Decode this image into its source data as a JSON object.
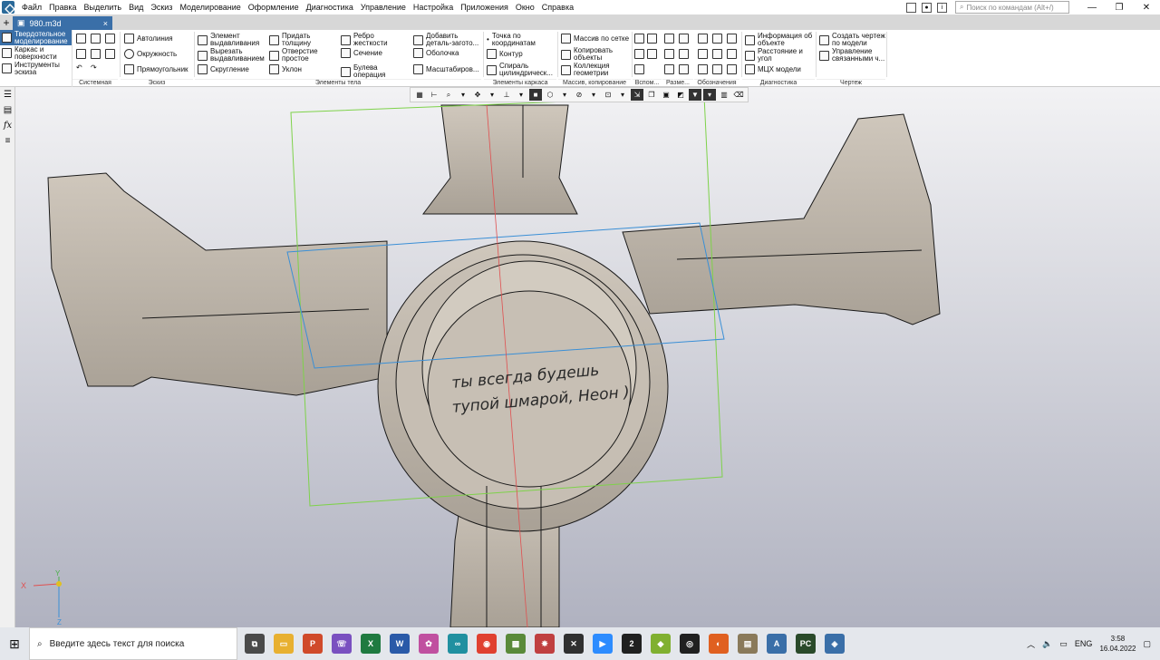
{
  "menu": [
    "Файл",
    "Правка",
    "Выделить",
    "Вид",
    "Эскиз",
    "Моделирование",
    "Оформление",
    "Диагностика",
    "Управление",
    "Настройка",
    "Приложения",
    "Окно",
    "Справка"
  ],
  "search": {
    "placeholder": "Поиск по командам (Alt+/)"
  },
  "tab": {
    "title": "980.m3d",
    "plus": "+",
    "close": "×"
  },
  "side": [
    "Твердотельное моделирование",
    "Каркас и поверхности",
    "Инструменты эскиза"
  ],
  "groups": {
    "system": "Системная",
    "sketch": "Эскиз",
    "body": "Элементы тела",
    "frame": "Элементы каркаса",
    "array": "Массив, копирование",
    "aux": "Вспом...",
    "size": "Разме...",
    "notation": "Обозначения",
    "diag": "Диагностика",
    "drawing": "Чертеж"
  },
  "sketch": [
    "Автолиния",
    "Окружность",
    "Прямоугольник"
  ],
  "body": [
    "Элемент выдавливания",
    "Вырезать выдавливанием",
    "Скругление",
    "Придать толщину",
    "Отверстие простое",
    "Уклон",
    "Ребро жесткости",
    "Сечение",
    "Булева операция",
    "Добавить деталь-загото...",
    "Оболочка",
    "Масштабиров..."
  ],
  "frame": [
    "Точка по координатам",
    "Контур",
    "Спираль цилиндрическ..."
  ],
  "array": [
    "Массив по сетке",
    "Копировать объекты",
    "Коллекция геометрии"
  ],
  "diag": [
    "Информация об объекте",
    "Расстояние и угол",
    "МЦХ модели"
  ],
  "drawing": [
    "Создать чертеж по модели",
    "Управление связанными ч..."
  ],
  "model": {
    "engraving_line1": "ты всегда будешь",
    "engraving_line2": "тупой шмарой, Неон )",
    "axis_x": "X",
    "axis_y": "Y",
    "axis_z": "Z"
  },
  "colors": {
    "body": "#c9c1b6",
    "body_dark": "#b3ab9f",
    "edge": "#1a1a1a",
    "accent": "#3a6fa8",
    "sketch_green": "#7ed24a",
    "plane_blue": "#3a8fd6",
    "axis_red": "#e05050"
  },
  "taskbar": {
    "search_placeholder": "Введите здесь текст для поиска",
    "lang": "ENG",
    "time": "3:58",
    "date": "16.04.2022"
  }
}
